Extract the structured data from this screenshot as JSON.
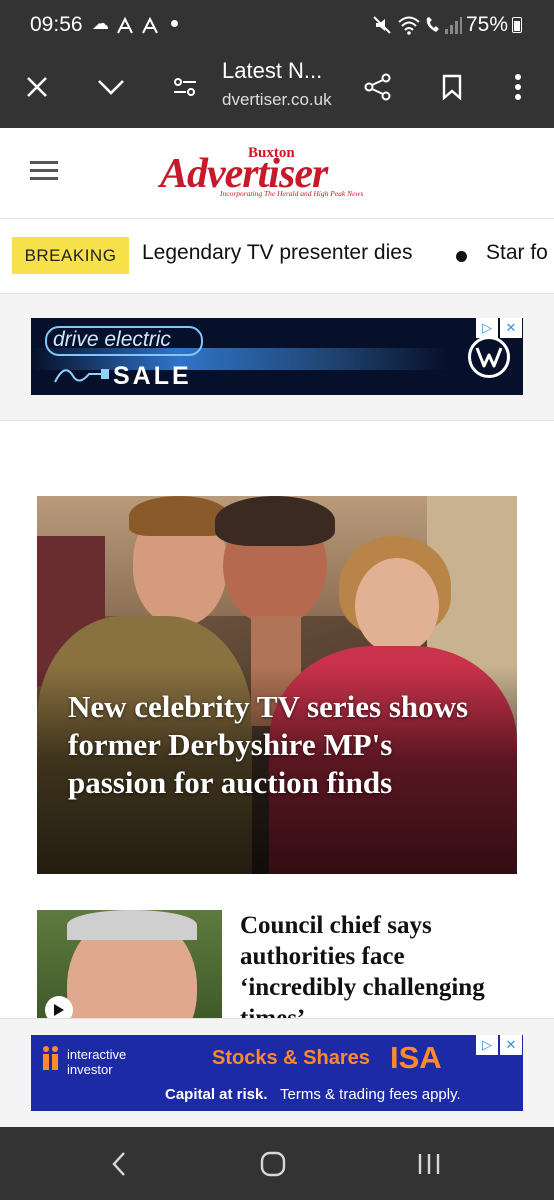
{
  "status_bar": {
    "time": "09:56",
    "battery": "75%",
    "icons": [
      "cloud-icon",
      "activity-icon",
      "activity-icon",
      "dot-icon",
      "mute-icon",
      "wifi-icon",
      "wifi-calling-icon",
      "signal-icon",
      "battery-icon"
    ]
  },
  "browser": {
    "title": "Latest N...",
    "url": "dvertiser.co.uk",
    "buttons": [
      "close-icon",
      "chevron-down-icon",
      "site-settings-icon",
      "share-icon",
      "bookmark-icon",
      "more-icon"
    ]
  },
  "site": {
    "logo_small": "Buxton",
    "logo_main": "Advertiser",
    "logo_tagline": "Incorporating The Herald and High Peak News"
  },
  "breaking": {
    "badge": "BREAKING",
    "headline": "Legendary TV presenter dies",
    "next_headline": "Star fo"
  },
  "top_ad": {
    "line1": "drive electric",
    "line2": "SALE",
    "brand_mark": "VW"
  },
  "hero": {
    "headline": "New celebrity TV series shows former Derbyshire MP's passion for auction finds"
  },
  "article2": {
    "headline": "Council chief says authorities face ‘incredibly challenging times’"
  },
  "bottom_ad": {
    "brand_line1": "interactive",
    "brand_line2": "investor",
    "product": "Stocks & Shares",
    "product_highlight": "ISA",
    "disclaimer_bold": "Capital at risk.",
    "disclaimer": "Terms & trading fees apply."
  },
  "colors": {
    "chrome_bg": "#333333",
    "breaking_yellow": "#f7e14b",
    "logo_red": "#c8192a",
    "ad_blue": "#1d2aa6",
    "isa_orange": "#ff8a2a"
  }
}
